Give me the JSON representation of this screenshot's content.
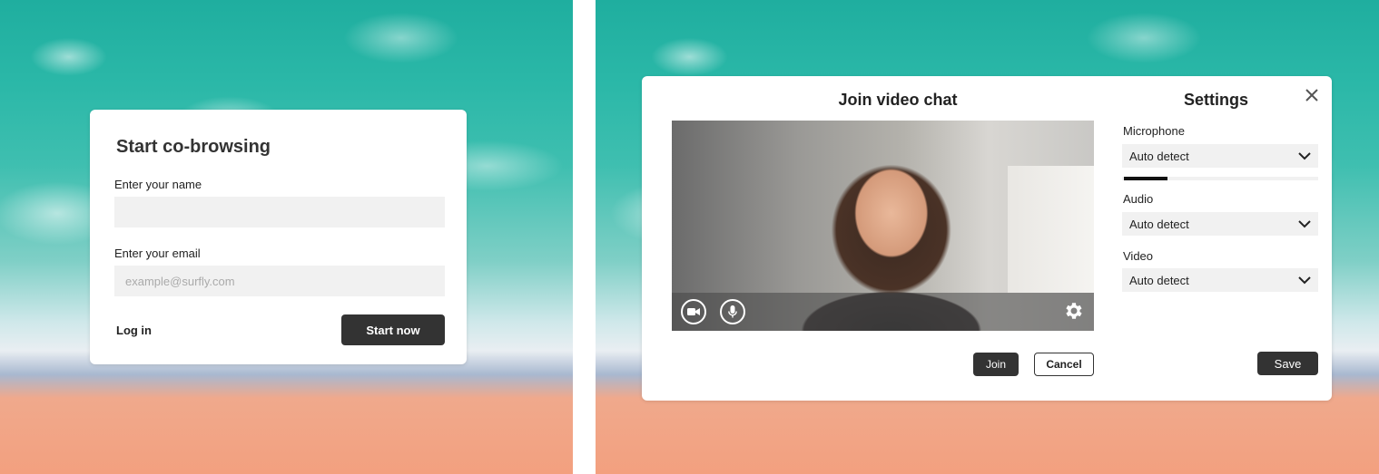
{
  "cobrowse": {
    "title": "Start co-browsing",
    "name_label": "Enter your name",
    "name_value": "",
    "name_placeholder": "",
    "email_label": "Enter your email",
    "email_value": "",
    "email_placeholder": "example@surfly.com",
    "login_label": "Log in",
    "start_label": "Start now"
  },
  "video_chat": {
    "title": "Join video chat",
    "camera_icon": "video-camera-icon",
    "mic_icon": "microphone-icon",
    "settings_icon": "gear-icon",
    "join_label": "Join",
    "cancel_label": "Cancel"
  },
  "settings": {
    "title": "Settings",
    "close_icon": "close-icon",
    "microphone_label": "Microphone",
    "microphone_value": "Auto detect",
    "microphone_level": 0.22,
    "audio_label": "Audio",
    "audio_value": "Auto detect",
    "video_label": "Video",
    "video_value": "Auto detect",
    "save_label": "Save"
  },
  "colors": {
    "button_dark": "#333333",
    "field_bg": "#f1f1f1"
  }
}
